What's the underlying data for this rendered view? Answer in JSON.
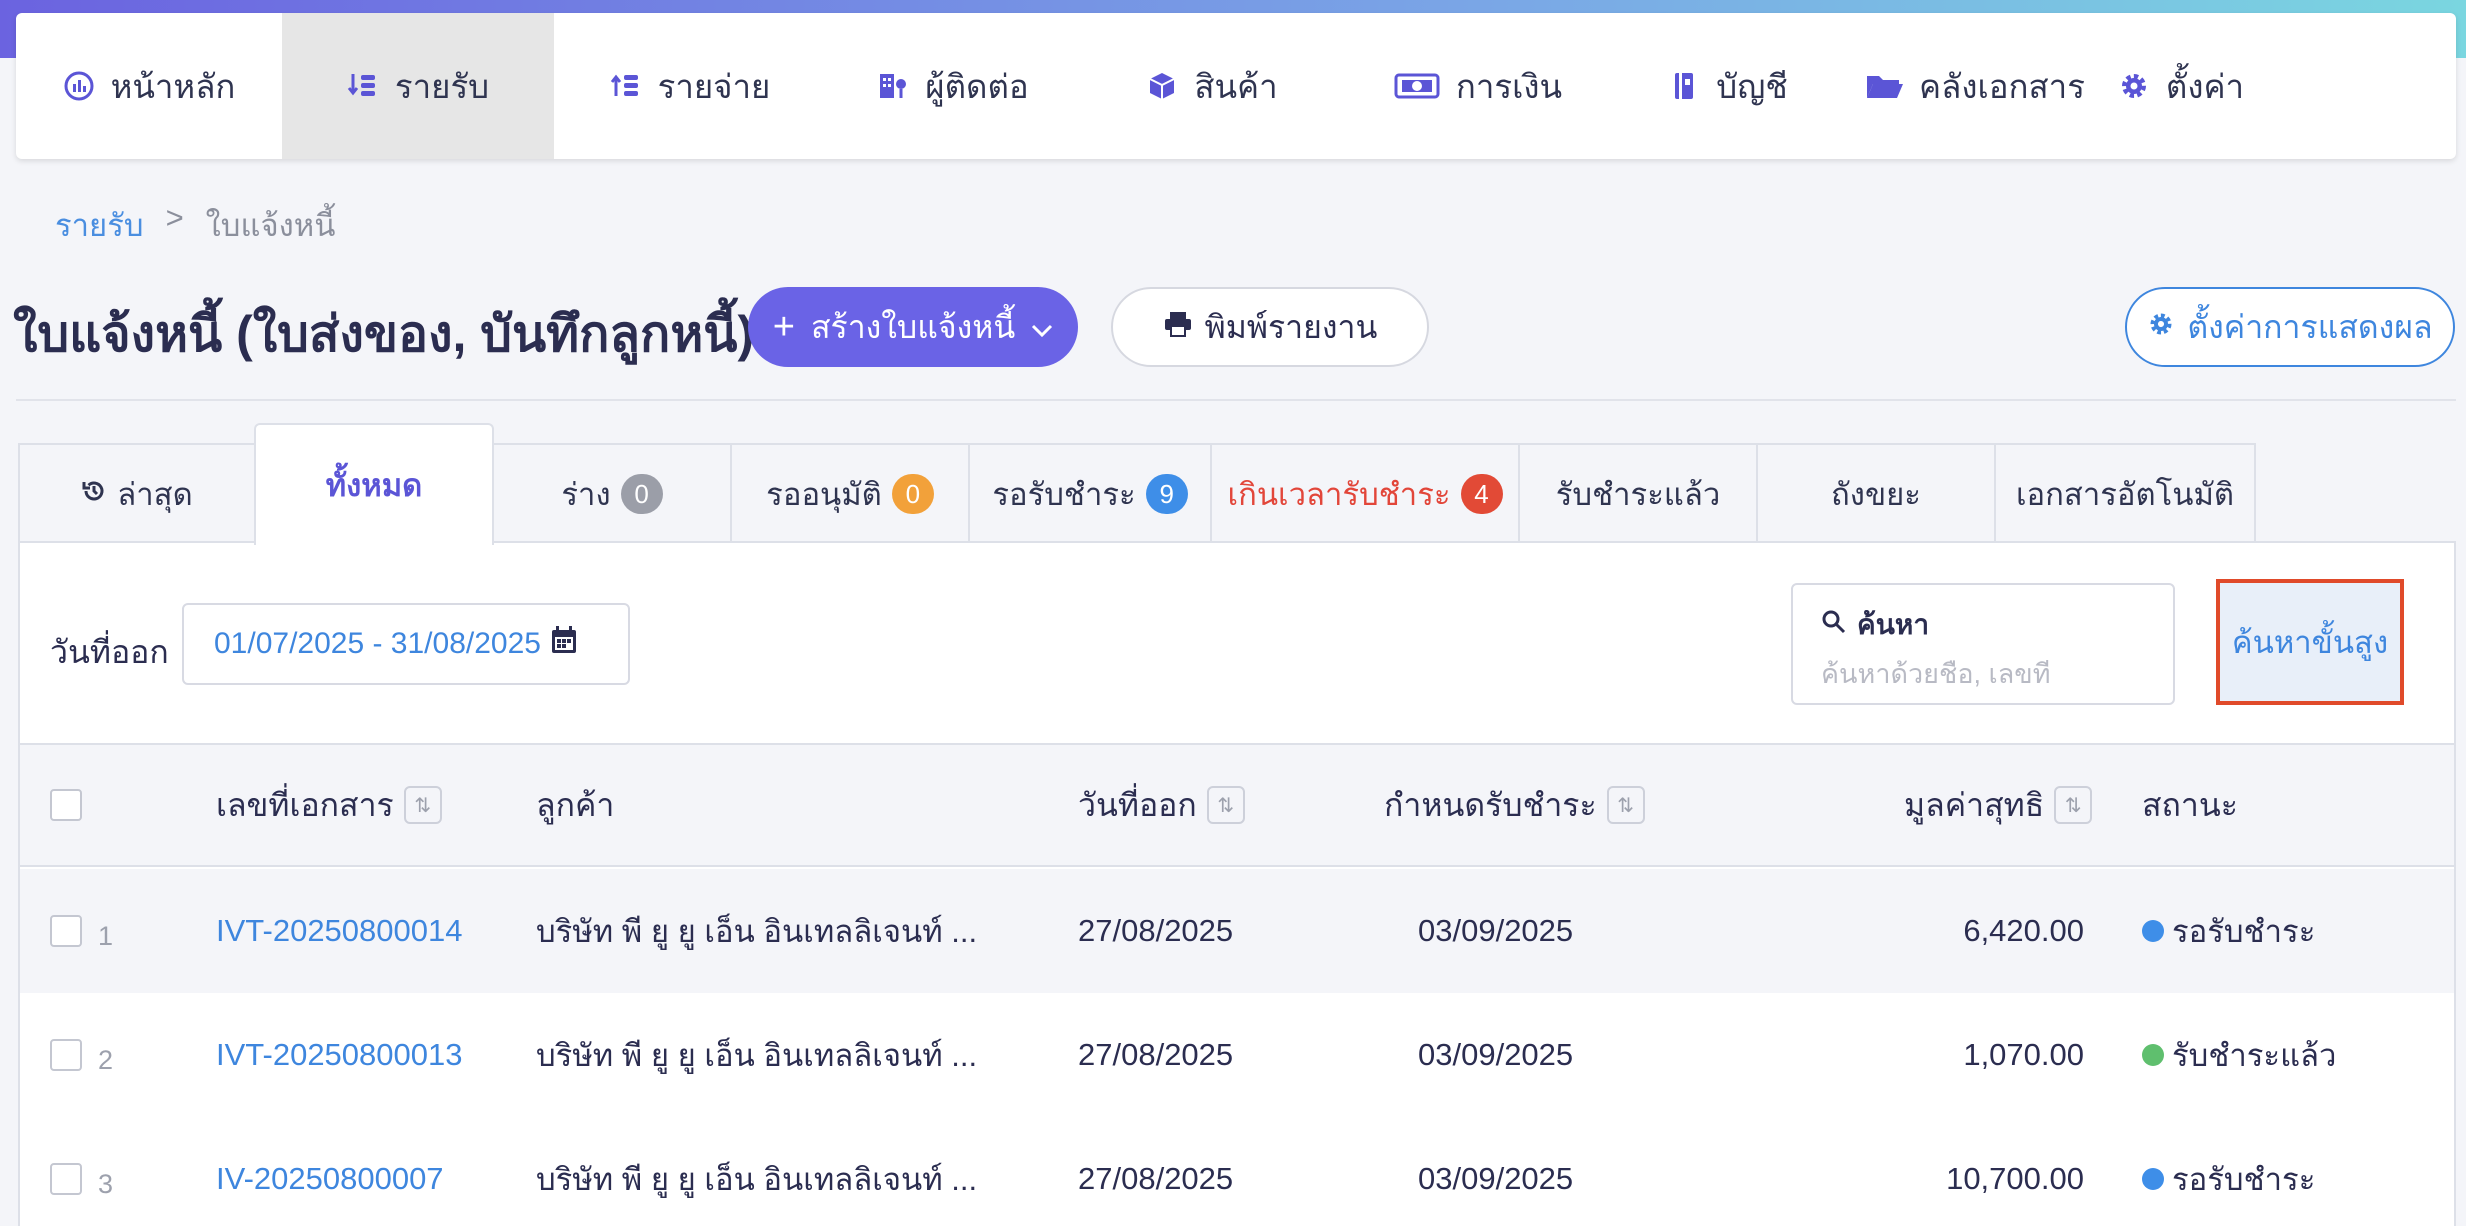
{
  "nav": {
    "items": [
      {
        "label": "หน้าหลัก",
        "icon": "dashboard-icon"
      },
      {
        "label": "รายรับ",
        "icon": "income-icon"
      },
      {
        "label": "รายจ่าย",
        "icon": "expense-icon"
      },
      {
        "label": "ผู้ติดต่อ",
        "icon": "contacts-icon"
      },
      {
        "label": "สินค้า",
        "icon": "product-box-icon"
      },
      {
        "label": "การเงิน",
        "icon": "money-icon"
      },
      {
        "label": "บัญชี",
        "icon": "ledger-icon"
      },
      {
        "label": "คลังเอกสาร",
        "icon": "folder-icon"
      },
      {
        "label": "ตั้งค่า",
        "icon": "gear-icon"
      }
    ]
  },
  "breadcrumb": {
    "parent": "รายรับ",
    "separator": ">",
    "current": "ใบแจ้งหนี้"
  },
  "page": {
    "title": "ใบแจ้งหนี้ (ใบส่งของ, บันทึกลูกหนี้)",
    "create_label": "สร้างใบแจ้งหนี้",
    "print_label": "พิมพ์รายงาน",
    "display_settings_label": "ตั้งค่าการแสดงผล"
  },
  "tabs": [
    {
      "label": "ล่าสุด"
    },
    {
      "label": "ทั้งหมด"
    },
    {
      "label": "ร่าง",
      "count": "0"
    },
    {
      "label": "รออนุมัติ",
      "count": "0"
    },
    {
      "label": "รอรับชำระ",
      "count": "9"
    },
    {
      "label": "เกินเวลารับชำระ",
      "count": "4"
    },
    {
      "label": "รับชำระแล้ว"
    },
    {
      "label": "ถังขยะ"
    },
    {
      "label": "เอกสารอัตโนมัติ"
    }
  ],
  "filters": {
    "date_label": "วันที่ออก",
    "date_range": "01/07/2025 - 31/08/2025",
    "search_title": "ค้นหา",
    "search_placeholder": "ค้นหาด้วยชื่อ, เลขที่",
    "advanced_label": "ค้นหาขั้นสูง"
  },
  "table": {
    "headers": {
      "doc_no": "เลขที่เอกสาร",
      "customer": "ลูกค้า",
      "issue_date": "วันที่ออก",
      "due_date": "กำหนดรับชำระ",
      "net": "มูลค่าสุทธิ",
      "status": "สถานะ"
    },
    "rows": [
      {
        "num": "1",
        "doc_no": "IVT-20250800014",
        "customer": "บริษัท พี ยู ยู เอ็น อินเทลลิเจนท์ ...",
        "issue_date": "27/08/2025",
        "due_date": "03/09/2025",
        "net": "6,420.00",
        "status": "รอรับชำระ",
        "status_color": "#3e8ee8"
      },
      {
        "num": "2",
        "doc_no": "IVT-20250800013",
        "customer": "บริษัท พี ยู ยู เอ็น อินเทลลิเจนท์ ...",
        "issue_date": "27/08/2025",
        "due_date": "03/09/2025",
        "net": "1,070.00",
        "status": "รับชำระแล้ว",
        "status_color": "#5fbf6e"
      },
      {
        "num": "3",
        "doc_no": "IV-20250800007",
        "customer": "บริษัท พี ยู ยู เอ็น อินเทลลิเจนท์ ...",
        "issue_date": "27/08/2025",
        "due_date": "03/09/2025",
        "net": "10,700.00",
        "status": "รอรับชำระ",
        "status_color": "#3e8ee8"
      }
    ]
  },
  "colors": {
    "accent": "#6a63e6",
    "link": "#3e86de",
    "danger": "#e2463a"
  }
}
